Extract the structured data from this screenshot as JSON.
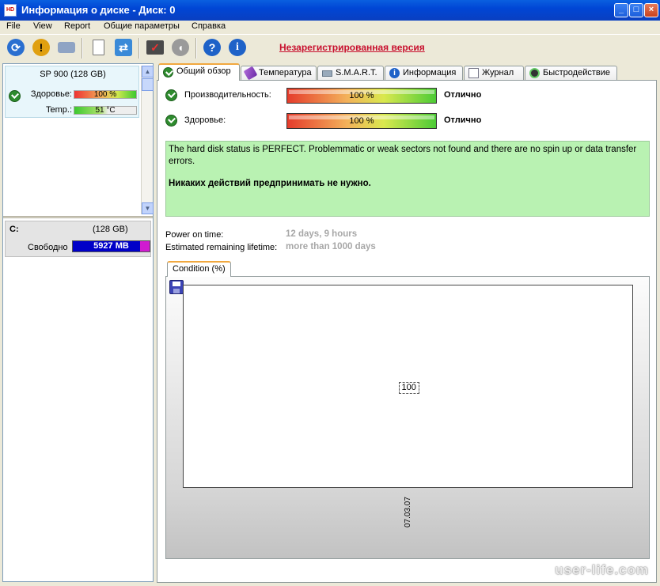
{
  "window": {
    "title": "Информация о диске - Диск: 0",
    "icon": "app-icon",
    "controls": [
      "minimize",
      "maximize",
      "close"
    ]
  },
  "menu": [
    "File",
    "View",
    "Report",
    "Общие параметры",
    "Справка"
  ],
  "toolbar": {
    "unregistered": "Незарегистрированная версия"
  },
  "left": {
    "disk": {
      "name": "SP 900  (128 GB)",
      "health_label": "Здоровье:",
      "health_value": "100 %",
      "temp_label": "Temp.:",
      "temp_value": "51 °C"
    },
    "partition": {
      "letter": "C:",
      "size": "(128 GB)",
      "free_label": "Свободно",
      "free_value": "5927 MB"
    }
  },
  "tabs": [
    {
      "label": "Общий обзор",
      "icon": "check-icon",
      "active": true
    },
    {
      "label": "Температура",
      "icon": "thermometer-icon"
    },
    {
      "label": "S.M.A.R.T.",
      "icon": "drive-icon"
    },
    {
      "label": "Информация",
      "icon": "info-icon"
    },
    {
      "label": "Журнал",
      "icon": "log-icon"
    },
    {
      "label": "Быстродействие",
      "icon": "speed-icon"
    }
  ],
  "overview": {
    "performance": {
      "label": "Производительность:",
      "value": "100 %",
      "percent": 100,
      "rating": "Отлично"
    },
    "health": {
      "label": "Здоровье:",
      "value": "100 %",
      "percent": 100,
      "rating": "Отлично"
    },
    "status_text": "The hard disk status is PERFECT. Problemmatic or weak sectors not found and there are no spin up or data transfer errors.",
    "action_text": "Никаких действий предпринимать не нужно.",
    "power_on_label": "Power on time:",
    "power_on_value": "12 days, 9 hours",
    "lifetime_label": "Estimated remaining lifetime:",
    "lifetime_value": "more than 1000 days",
    "subtab": "Condition (%)"
  },
  "chart_data": {
    "type": "line",
    "x": [
      "07.03.07"
    ],
    "values": [
      100
    ],
    "data_labels": [
      "100"
    ],
    "ylim": [
      0,
      100
    ]
  },
  "watermark": "user-life.com"
}
